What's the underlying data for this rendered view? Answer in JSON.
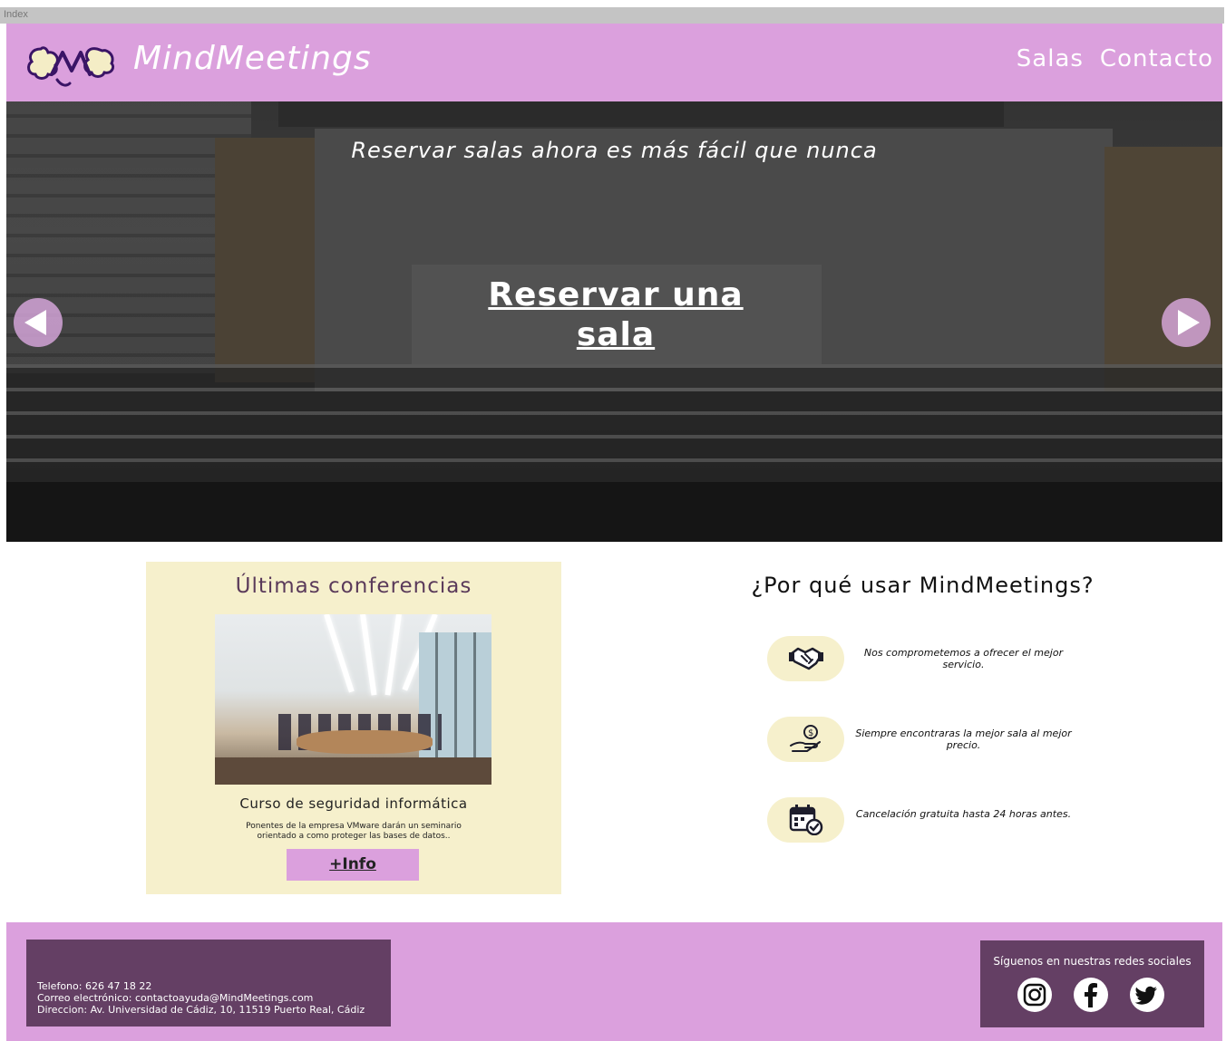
{
  "browser": {
    "tab_title": "Index"
  },
  "header": {
    "brand": "MindMeetings",
    "nav": [
      {
        "label": "Salas"
      },
      {
        "label": "Contacto"
      }
    ],
    "accent_color": "#dba0dd"
  },
  "hero": {
    "tagline": "Reservar salas ahora es más fácil que nunca",
    "cta_label": "Reservar una sala",
    "prev_icon": "arrow-left-icon",
    "next_icon": "arrow-right-icon"
  },
  "conferences": {
    "title": "Últimas conferencias",
    "course_title": "Curso de seguridad informática",
    "description": "Ponentes de la empresa VMware darán un seminario orientado a como proteger las bases de datos..",
    "button_label": "+Info",
    "card_color": "#f6f0cc"
  },
  "why": {
    "title": "¿Por qué usar MindMeetings?",
    "items": [
      {
        "icon": "handshake-icon",
        "text": "Nos comprometemos a ofrecer el mejor servicio."
      },
      {
        "icon": "money-hand-icon",
        "text": "Siempre encontraras la mejor sala al mejor precio."
      },
      {
        "icon": "calendar-check-icon",
        "text": "Cancelación gratuita hasta 24 horas antes."
      }
    ]
  },
  "footer": {
    "phone": "Telefono: 626 47 18 22",
    "email": "Correo electrónico: contactoayuda@MindMeetings.com",
    "address": "Direccion: Av. Universidad de Cádiz, 10, 11519 Puerto Real, Cádiz",
    "social_title": "Síguenos en nuestras redes sociales",
    "social": [
      "instagram-icon",
      "facebook-icon",
      "twitter-icon"
    ],
    "box_color": "#643f64"
  }
}
